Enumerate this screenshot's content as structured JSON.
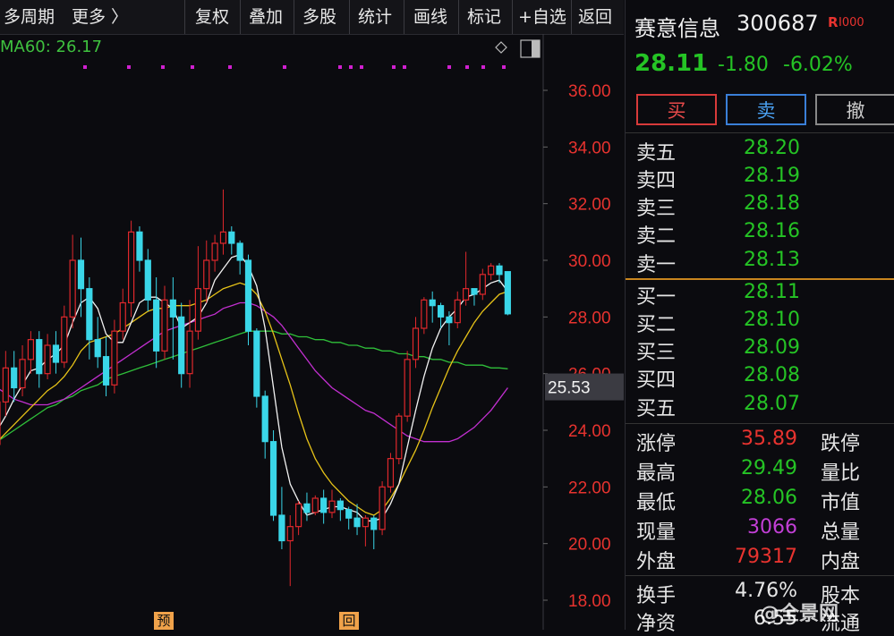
{
  "toolbar": {
    "items": [
      "多周期",
      "更多 〉",
      "复权",
      "叠加",
      "多股",
      "统计",
      "画线",
      "标记",
      "+自选",
      "返回"
    ]
  },
  "chart": {
    "ma_label": "MA60: 26.17",
    "price_axis": [
      "36.00",
      "34.00",
      "32.00",
      "30.00",
      "28.00",
      "26.00",
      "24.00",
      "22.00",
      "20.00",
      "18.00"
    ],
    "cursor_price": "25.53",
    "markers": [
      "预",
      "回"
    ],
    "colors": {
      "up": "#e0282c",
      "down": "#3ad6e8",
      "axis": "#e8332f",
      "ma5": "#f2f2f2",
      "ma10": "#e7c318",
      "ma20": "#c22fd0",
      "ma60": "#2fbf3a"
    }
  },
  "chart_data": {
    "type": "candlestick",
    "title": "",
    "ylim": [
      17.5,
      37.5
    ],
    "candles": [
      [
        23.5,
        25.0,
        22.8,
        25.6
      ],
      [
        25.0,
        26.2,
        24.5,
        26.8
      ],
      [
        26.2,
        25.5,
        25.0,
        26.8
      ],
      [
        25.5,
        26.5,
        25.2,
        27.0
      ],
      [
        26.5,
        27.2,
        26.0,
        27.5
      ],
      [
        27.2,
        26.0,
        25.5,
        27.5
      ],
      [
        26.0,
        27.0,
        25.8,
        27.4
      ],
      [
        27.0,
        26.4,
        26.0,
        27.5
      ],
      [
        26.4,
        28.0,
        26.2,
        28.4
      ],
      [
        28.0,
        30.0,
        27.6,
        30.9
      ],
      [
        30.0,
        29.0,
        28.0,
        30.8
      ],
      [
        29.0,
        27.2,
        26.5,
        29.4
      ],
      [
        27.2,
        26.6,
        26.2,
        28.0
      ],
      [
        26.6,
        25.6,
        25.2,
        27.3
      ],
      [
        25.6,
        27.5,
        25.3,
        27.9
      ],
      [
        27.5,
        28.5,
        27.2,
        29.0
      ],
      [
        28.5,
        31.0,
        28.0,
        31.4
      ],
      [
        31.0,
        30.0,
        29.6,
        31.2
      ],
      [
        30.0,
        28.6,
        28.2,
        30.4
      ],
      [
        28.6,
        26.8,
        26.2,
        29.4
      ],
      [
        26.8,
        28.6,
        26.5,
        29.1
      ],
      [
        28.6,
        28.0,
        26.5,
        29.4
      ],
      [
        28.0,
        26.0,
        25.5,
        28.5
      ],
      [
        26.0,
        27.5,
        25.5,
        28.6
      ],
      [
        27.5,
        29.0,
        27.2,
        30.5
      ],
      [
        29.0,
        30.0,
        28.5,
        30.7
      ],
      [
        30.0,
        30.6,
        29.6,
        30.9
      ],
      [
        30.6,
        31.0,
        30.2,
        32.5
      ],
      [
        31.0,
        30.6,
        30.2,
        31.2
      ],
      [
        30.6,
        30.0,
        29.5,
        30.7
      ],
      [
        30.0,
        27.5,
        27.0,
        30.2
      ],
      [
        27.5,
        25.2,
        24.8,
        27.6
      ],
      [
        25.2,
        23.6,
        23.0,
        25.4
      ],
      [
        23.6,
        21.0,
        20.8,
        24.0
      ],
      [
        21.0,
        20.1,
        19.8,
        22.0
      ],
      [
        20.1,
        20.6,
        18.5,
        21.0
      ],
      [
        20.6,
        21.4,
        20.3,
        21.5
      ],
      [
        21.4,
        21.1,
        20.8,
        21.8
      ],
      [
        21.1,
        21.6,
        21.0,
        21.7
      ],
      [
        21.6,
        21.1,
        20.7,
        21.9
      ],
      [
        21.1,
        21.5,
        20.9,
        21.9
      ],
      [
        21.5,
        21.2,
        20.8,
        21.6
      ],
      [
        21.2,
        20.9,
        20.5,
        21.3
      ],
      [
        20.9,
        20.6,
        20.3,
        21.4
      ],
      [
        20.6,
        20.9,
        19.9,
        21.0
      ],
      [
        20.9,
        20.5,
        19.8,
        21.0
      ],
      [
        20.5,
        22.0,
        20.3,
        22.2
      ],
      [
        22.0,
        23.0,
        21.8,
        23.2
      ],
      [
        23.0,
        24.5,
        22.8,
        24.6
      ],
      [
        24.5,
        26.5,
        24.3,
        26.8
      ],
      [
        26.5,
        27.6,
        26.2,
        28.0
      ],
      [
        27.6,
        28.6,
        27.4,
        28.7
      ],
      [
        28.6,
        28.4,
        27.8,
        28.9
      ],
      [
        28.4,
        28.0,
        27.6,
        28.5
      ],
      [
        28.0,
        27.8,
        27.0,
        28.2
      ],
      [
        27.8,
        28.6,
        27.6,
        28.9
      ],
      [
        28.6,
        29.0,
        28.4,
        30.3
      ],
      [
        29.0,
        28.8,
        28.4,
        29.0
      ],
      [
        28.8,
        29.5,
        28.6,
        29.7
      ],
      [
        29.5,
        29.8,
        29.3,
        29.9
      ],
      [
        29.8,
        29.5,
        29.2,
        29.9
      ],
      [
        29.6,
        28.11,
        28.06,
        29.49
      ]
    ],
    "ma5": [
      24.0,
      24.5,
      25.1,
      25.6,
      26.1,
      26.2,
      26.5,
      26.7,
      27.0,
      27.8,
      28.5,
      28.7,
      28.3,
      27.4,
      27.1,
      27.1,
      27.8,
      28.5,
      28.7,
      28.7,
      28.5,
      28.3,
      27.6,
      27.8,
      28.0,
      28.5,
      29.3,
      29.7,
      30.1,
      30.2,
      29.8,
      29.1,
      27.6,
      25.5,
      23.4,
      22.1,
      21.5,
      21.0,
      21.1,
      21.2,
      21.3,
      21.3,
      21.2,
      21.1,
      20.8,
      20.8,
      20.9,
      21.4,
      22.1,
      23.4,
      24.7,
      25.9,
      26.9,
      27.6,
      28.0,
      28.3,
      28.7,
      28.8,
      29.0,
      29.2,
      29.3,
      28.9
    ],
    "ma10": [
      23.6,
      23.9,
      24.2,
      24.5,
      24.8,
      25.1,
      25.4,
      25.6,
      25.9,
      26.3,
      26.8,
      27.1,
      27.2,
      27.3,
      27.4,
      27.6,
      27.8,
      28.0,
      28.2,
      28.3,
      28.3,
      28.4,
      28.4,
      28.4,
      28.5,
      28.6,
      28.8,
      29.0,
      29.1,
      29.2,
      29.1,
      28.8,
      28.2,
      27.4,
      26.5,
      25.6,
      24.6,
      23.7,
      23.0,
      22.5,
      22.1,
      21.8,
      21.5,
      21.3,
      21.1,
      21.0,
      21.2,
      21.6,
      22.1,
      22.7,
      23.3,
      24.0,
      24.8,
      25.5,
      26.2,
      26.8,
      27.3,
      27.8,
      28.2,
      28.5,
      28.8,
      28.9
    ],
    "ma20": [
      25.5,
      25.3,
      25.1,
      25.0,
      24.9,
      24.9,
      24.9,
      25.0,
      25.1,
      25.3,
      25.5,
      25.7,
      25.9,
      26.1,
      26.3,
      26.5,
      26.7,
      26.9,
      27.1,
      27.3,
      27.5,
      27.6,
      27.7,
      27.8,
      27.9,
      28.0,
      28.1,
      28.3,
      28.4,
      28.5,
      28.5,
      28.4,
      28.2,
      28.0,
      27.7,
      27.3,
      26.9,
      26.5,
      26.1,
      25.8,
      25.5,
      25.3,
      25.1,
      24.9,
      24.7,
      24.6,
      24.4,
      24.2,
      24.0,
      23.8,
      23.7,
      23.6,
      23.6,
      23.6,
      23.6,
      23.7,
      23.9,
      24.1,
      24.4,
      24.7,
      25.1,
      25.5
    ],
    "ma60": [
      23.6,
      23.8,
      24.0,
      24.2,
      24.4,
      24.6,
      24.8,
      24.9,
      25.1,
      25.2,
      25.4,
      25.5,
      25.6,
      25.8,
      25.9,
      26.0,
      26.1,
      26.2,
      26.3,
      26.4,
      26.5,
      26.6,
      26.7,
      26.8,
      26.9,
      27.0,
      27.1,
      27.2,
      27.3,
      27.4,
      27.5,
      27.5,
      27.5,
      27.5,
      27.4,
      27.4,
      27.3,
      27.3,
      27.2,
      27.2,
      27.1,
      27.1,
      27.0,
      27.0,
      26.9,
      26.9,
      26.8,
      26.8,
      26.7,
      26.7,
      26.6,
      26.6,
      26.5,
      26.5,
      26.4,
      26.4,
      26.3,
      26.3,
      26.3,
      26.2,
      26.2,
      26.17
    ]
  },
  "quote": {
    "name": "赛意信息",
    "code": "300687",
    "badge": "R",
    "badge2": "I000",
    "price": "28.11",
    "change": "-1.80",
    "change_pct": "-6.02%"
  },
  "buttons": {
    "buy": "买",
    "sell": "卖",
    "cancel": "撤"
  },
  "orderbook": {
    "asks": [
      {
        "label": "卖五",
        "price": "28.20"
      },
      {
        "label": "卖四",
        "price": "28.19"
      },
      {
        "label": "卖三",
        "price": "28.18"
      },
      {
        "label": "卖二",
        "price": "28.16"
      },
      {
        "label": "卖一",
        "price": "28.13"
      }
    ],
    "bids": [
      {
        "label": "买一",
        "price": "28.11"
      },
      {
        "label": "买二",
        "price": "28.10"
      },
      {
        "label": "买三",
        "price": "28.09"
      },
      {
        "label": "买四",
        "price": "28.08"
      },
      {
        "label": "买五",
        "price": "28.07"
      }
    ]
  },
  "stats": {
    "limit_up_label": "涨停",
    "limit_up": "35.89",
    "limit_down_label": "跌停",
    "high_label": "最高",
    "high": "29.49",
    "vol_ratio_label": "量比",
    "low_label": "最低",
    "low": "28.06",
    "mktcap_label": "市值",
    "cur_vol_label": "现量",
    "cur_vol": "3066",
    "total_vol_label": "总量",
    "outer_label": "外盘",
    "outer": "79317",
    "inner_label": "内盘",
    "turnover_label": "换手",
    "turnover": "4.76%",
    "shares_label": "股本",
    "net_label": "净资",
    "net": "6.55",
    "float_label": "流通"
  },
  "watermark": "@全景网"
}
